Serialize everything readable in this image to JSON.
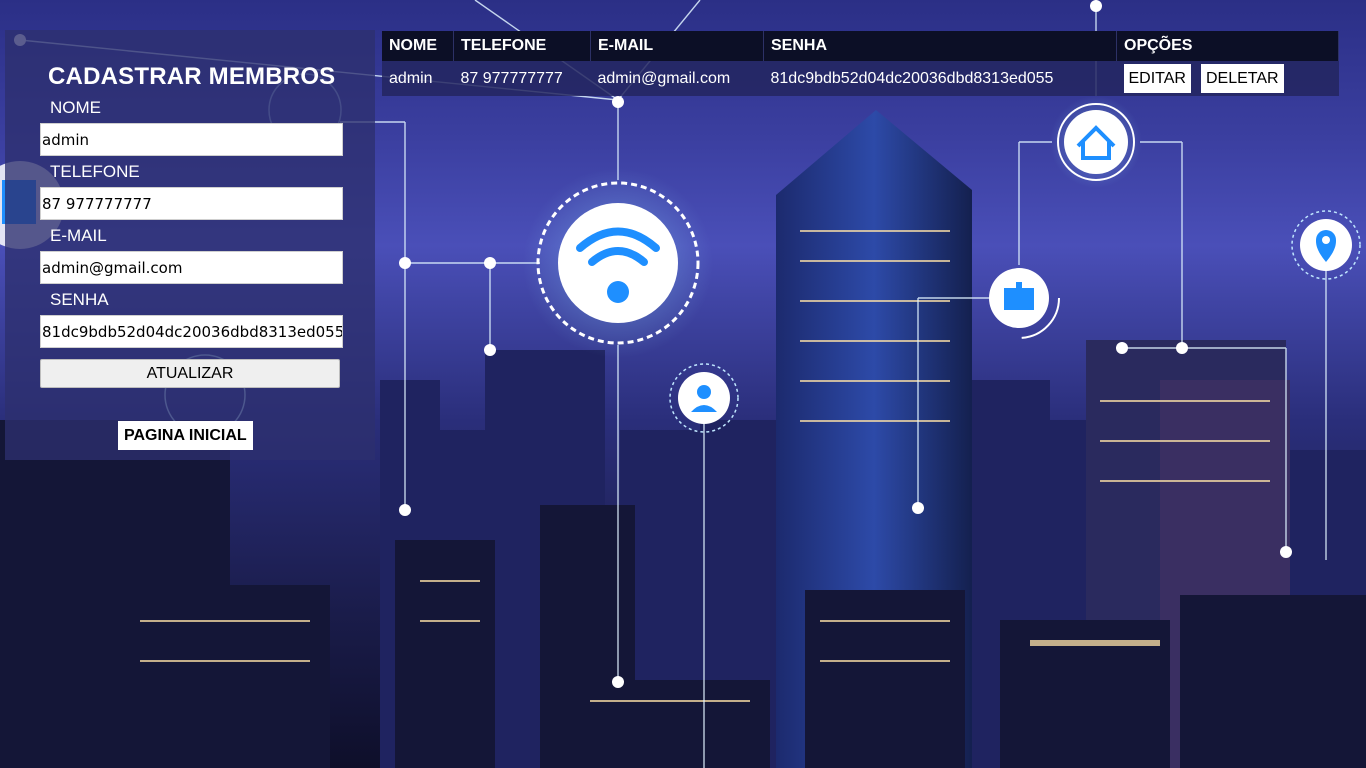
{
  "form": {
    "title": "CADASTRAR MEMBROS",
    "fields": [
      {
        "label": "NOME",
        "value": "admin"
      },
      {
        "label": "TELEFONE",
        "value": "87 977777777"
      },
      {
        "label": "E-MAIL",
        "value": "admin@gmail.com"
      },
      {
        "label": "SENHA",
        "value": "81dc9bdb52d04dc20036dbd8313ed055"
      }
    ],
    "update_label": "ATUALIZAR",
    "home_label": "PAGINA INICIAL"
  },
  "table": {
    "headers": [
      "NOME",
      "TELEFONE",
      "E-MAIL",
      "SENHA",
      "OPÇÕES"
    ],
    "rows": [
      {
        "nome": "admin",
        "telefone": "87 977777777",
        "email": "admin@gmail.com",
        "senha": "81dc9bdb52d04dc20036dbd8313ed055",
        "edit_label": "EDITAR",
        "delete_label": "DELETAR"
      }
    ]
  },
  "background": {
    "icons": [
      "wifi-icon",
      "home-icon",
      "hospital-icon",
      "location-pin-icon",
      "user-icon",
      "building-icon",
      "tower-icon"
    ],
    "colors": {
      "sky": "#3b3fa0",
      "accent": "#1e90ff",
      "panel": "#2d306e"
    }
  }
}
